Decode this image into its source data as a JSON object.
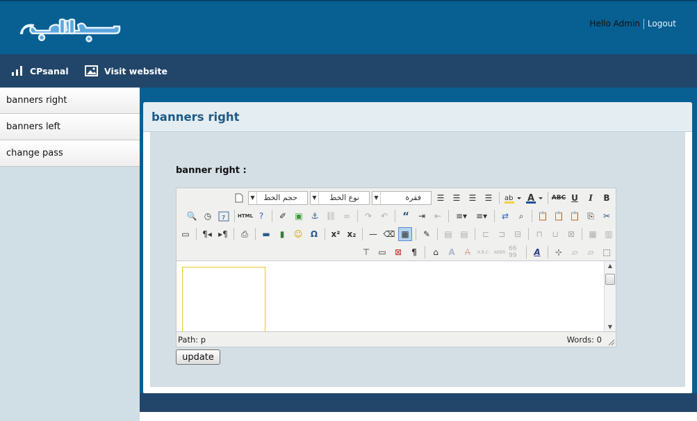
{
  "header": {
    "logo_text": "صح اليوم",
    "greeting": "Hello Admin",
    "logout_label": "Logout"
  },
  "nav": {
    "items": [
      {
        "label": "CPsanal",
        "icon": "bar-chart-icon"
      },
      {
        "label": "Visit website",
        "icon": "picture-icon"
      }
    ]
  },
  "sidebar": {
    "items": [
      {
        "label": "banners right"
      },
      {
        "label": "banners left"
      },
      {
        "label": "change pass"
      }
    ]
  },
  "main": {
    "title": "banners right",
    "field_label": "banner right :",
    "editor": {
      "font_size_placeholder": "حجم الخط",
      "font_name_placeholder": "نوع الخط",
      "format_value": "فقرة",
      "path_label": "Path: p",
      "words_label": "Words: 0"
    },
    "update_label": "update"
  },
  "colors": {
    "header_bg": "#075f92",
    "nav_bg": "#22466a",
    "panel_title": "#1f5b85",
    "panel_body": "#d3dfe5"
  }
}
